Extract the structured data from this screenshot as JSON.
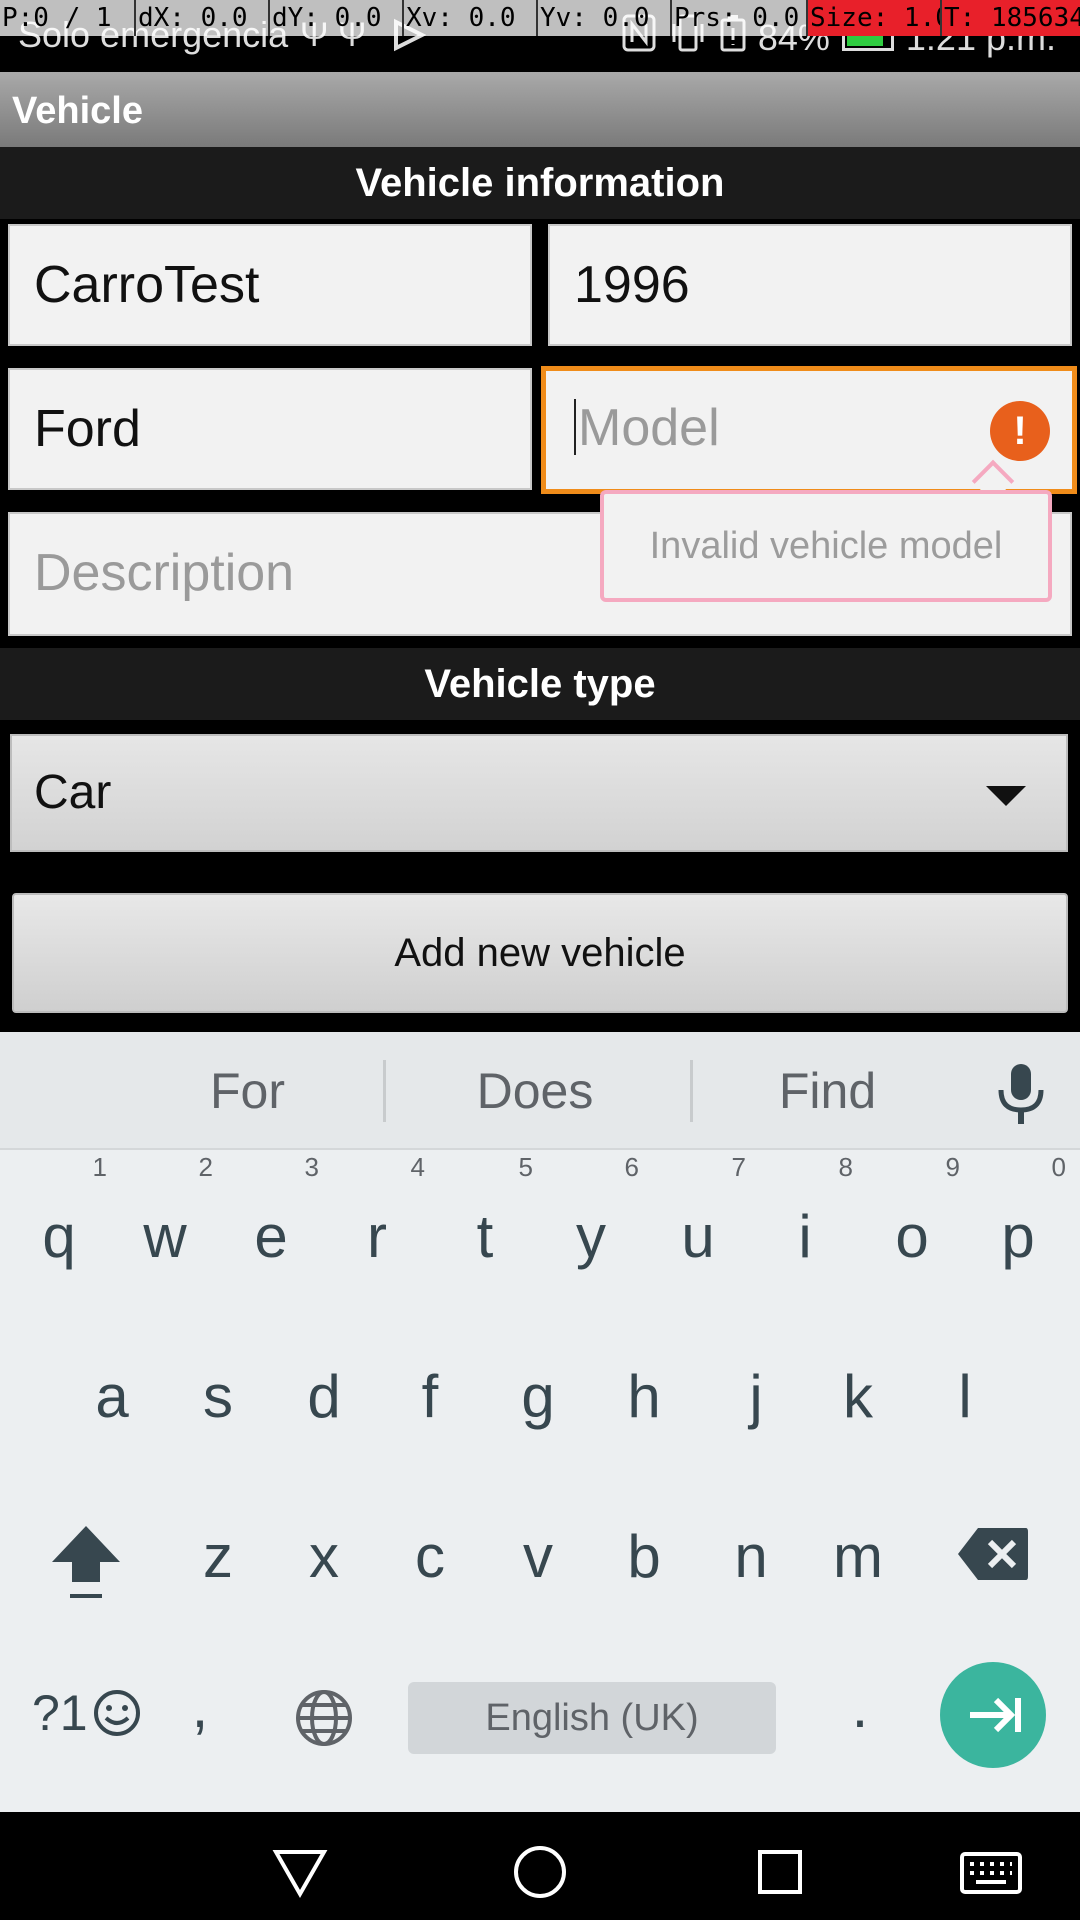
{
  "statusbar": {
    "carrier": "Solo emergencia",
    "usb_icons": "Ψ Ψ",
    "battery": "84%",
    "time": "1:21 p.m."
  },
  "debug": {
    "p": "P:0 / 1",
    "dx": "dX: 0.0",
    "dy": "dY: 0.0",
    "xv": "Xv: 0.0",
    "yv": "Yv: 0.0",
    "prs": "Prs: 0.0",
    "size": "Size: 1.0",
    "t": "T: 185634"
  },
  "actionbar": {
    "title": "Vehicle"
  },
  "form": {
    "section_info": "Vehicle information",
    "name_value": "CarroTest",
    "year_value": "1996",
    "make_value": "Ford",
    "model_placeholder": "Model",
    "description_placeholder": "Description",
    "error_tooltip": "Invalid vehicle model",
    "error_glyph": "!",
    "section_type": "Vehicle type",
    "type_selected": "Car",
    "add_button": "Add new vehicle"
  },
  "keyboard": {
    "suggestions": [
      "For",
      "Does",
      "Find"
    ],
    "row1": [
      {
        "key": "q",
        "hint": "1"
      },
      {
        "key": "w",
        "hint": "2"
      },
      {
        "key": "e",
        "hint": "3"
      },
      {
        "key": "r",
        "hint": "4"
      },
      {
        "key": "t",
        "hint": "5"
      },
      {
        "key": "y",
        "hint": "6"
      },
      {
        "key": "u",
        "hint": "7"
      },
      {
        "key": "i",
        "hint": "8"
      },
      {
        "key": "o",
        "hint": "9"
      },
      {
        "key": "p",
        "hint": "0"
      }
    ],
    "row2": [
      "a",
      "s",
      "d",
      "f",
      "g",
      "h",
      "j",
      "k",
      "l"
    ],
    "row3": [
      "z",
      "x",
      "c",
      "v",
      "b",
      "n",
      "m"
    ],
    "symbols_label": "?1",
    "comma": ",",
    "period": ".",
    "space_label": "English (UK)"
  },
  "colors": {
    "focus_border": "#f08c1a",
    "error_icon": "#e8601c",
    "tooltip_border": "#f5a9c0",
    "enter_key": "#3bb59e"
  }
}
